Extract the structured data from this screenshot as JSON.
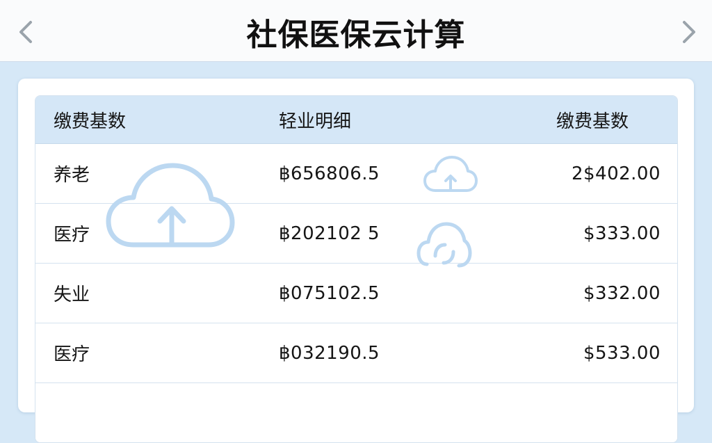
{
  "header": {
    "title": "社保医保云计算",
    "prev_icon": "chevron-left-icon",
    "next_icon": "chevron-right-icon"
  },
  "table": {
    "columns": [
      "缴费基数",
      "轻业明细",
      "缴费基数"
    ],
    "rows": [
      {
        "name": "养老",
        "detail": "฿656806.5",
        "amount": "2$402.00"
      },
      {
        "name": "医疗",
        "detail": "฿202102 5",
        "amount": "$333.00"
      },
      {
        "name": "失业",
        "detail": "฿075102.5",
        "amount": "$332.00"
      },
      {
        "name": "医疗",
        "detail": "฿032190.5",
        "amount": "$533.00"
      }
    ]
  },
  "decorations": [
    "cloud-upload-icon",
    "cloud-upload-icon",
    "cloud-sync-icon"
  ],
  "colors": {
    "background": "#d6e8f7",
    "header_row": "#d5e7f7",
    "cloud_stroke": "#bcd8f1"
  }
}
